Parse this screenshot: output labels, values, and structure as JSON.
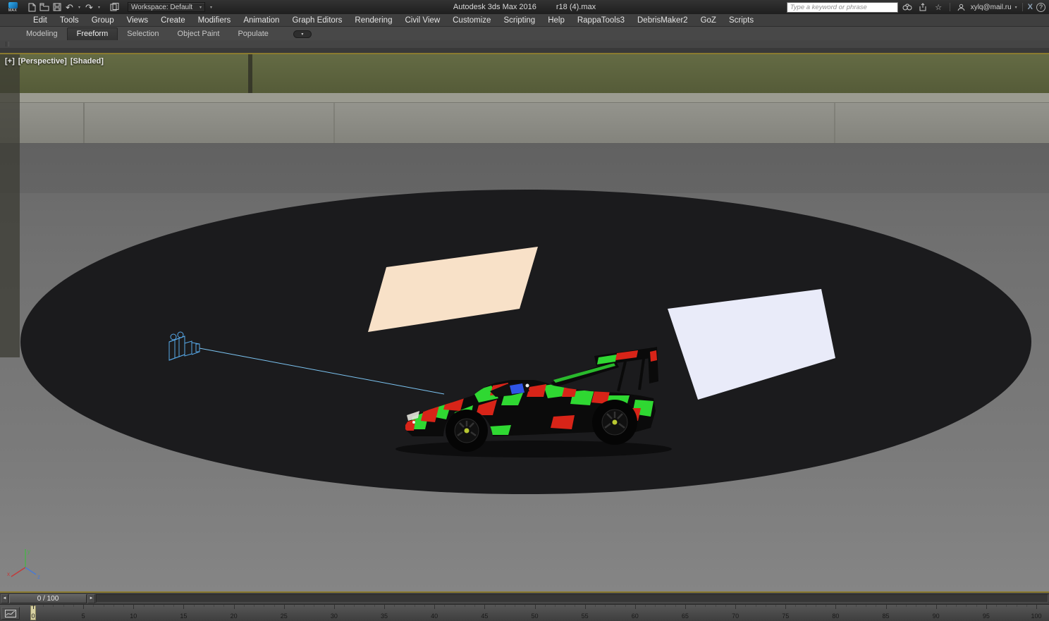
{
  "titlebar": {
    "app_badge": "MAX",
    "workspace": "Workspace: Default",
    "title_app": "Autodesk 3ds Max 2016",
    "title_file": "r18 (4).max",
    "search_placeholder": "Type a keyword or phrase",
    "user_email": "xylq@mail.ru"
  },
  "icons": {
    "undo_glyph": "↶",
    "redo_glyph": "↷",
    "favorites_glyph": "☆",
    "caret_glyph": "▾",
    "help_glyph": "?",
    "exchange_glyph": "X",
    "prev_glyph": "◄",
    "next_glyph": "►"
  },
  "menubar": {
    "items": [
      "Edit",
      "Tools",
      "Group",
      "Views",
      "Create",
      "Modifiers",
      "Animation",
      "Graph Editors",
      "Rendering",
      "Civil View",
      "Customize",
      "Scripting",
      "Help",
      "RappaTools3",
      "DebrisMaker2",
      "GoZ",
      "Scripts"
    ]
  },
  "ribbon": {
    "tabs": [
      "Modeling",
      "Freeform",
      "Selection",
      "Object Paint",
      "Populate"
    ],
    "active_tab": "Freeform"
  },
  "viewport": {
    "label_plus": "[+]",
    "label_view": "[Perspective]",
    "label_shading": "[Shaded]"
  },
  "timeline": {
    "slider_value": "0 / 100"
  },
  "trackbar": {
    "frame_min": 0,
    "frame_max": 100,
    "number_step": 5,
    "current_frame": 0,
    "numbers": [
      0,
      5,
      10,
      15,
      20,
      25,
      30,
      35,
      40,
      45,
      50,
      55,
      60,
      65,
      70,
      75,
      80,
      85,
      90,
      95,
      100
    ]
  },
  "scene": {
    "colors": {
      "ground_disc": "#1b1b1d",
      "plane_peach": "#f8e1c8",
      "plane_white": "#e9ebf9",
      "camera_wire": "#57a8e8",
      "car_green": "#2fd832",
      "car_red": "#d82418"
    }
  }
}
